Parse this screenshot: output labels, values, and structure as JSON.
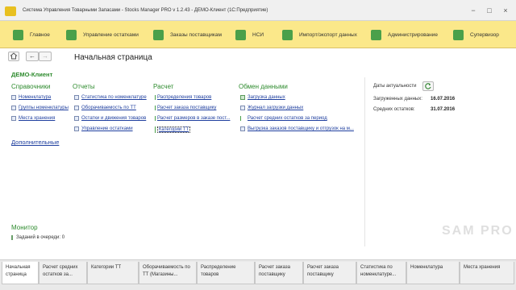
{
  "window": {
    "title": "Система Управления Товарными Запасами - Stocks Manager PRO v 1.2.43 - ДЕМО-Клиент (1С:Предприятие)",
    "controls": [
      "−",
      "□",
      "×"
    ]
  },
  "sections": [
    {
      "label": "Главное",
      "icon": "home-icon",
      "color": "#4aa04a"
    },
    {
      "label": "Управление остатками",
      "icon": "stock-icon",
      "color": "#4aa04a"
    },
    {
      "label": "Заказы поставщикам",
      "icon": "orders-icon",
      "color": "#4aa04a"
    },
    {
      "label": "НСИ",
      "icon": "reference-data-icon",
      "color": "#4aa04a"
    },
    {
      "label": "Импорт/экспорт данных",
      "icon": "import-export-icon",
      "color": "#4aa04a"
    },
    {
      "label": "Администрирование",
      "icon": "admin-icon",
      "color": "#4aa04a"
    },
    {
      "label": "Супервизор",
      "icon": "supervisor-icon",
      "color": "#4aa04a"
    }
  ],
  "nav": {
    "home_icon": "house-icon",
    "back": "←",
    "forward": "→",
    "page_title": "Начальная страница"
  },
  "client_name": "ДЕМО-Клиент",
  "columns": [
    {
      "title": "Справочники",
      "links": [
        "Номенклатура",
        "Группы номенклатуры",
        "Места хранения"
      ]
    },
    {
      "title": "Отчеты",
      "links": [
        "Статистика по номенклатуре",
        "Оборачиваемость по ТТ",
        "Остатки и движения товаров",
        "Управление остатками"
      ]
    },
    {
      "title": "Расчет",
      "links": [
        "Распределения товаров",
        "Расчет заказа поставщику",
        "Расчет размеров в заказе пост...",
        "Категории ТТ"
      ]
    },
    {
      "title": "Обмен данными",
      "links": [
        "Загрузка данных",
        "Журнал загрузки данных",
        "Расчет средних остатков за период",
        "Выгрузка заказов поставщику и отгрузок на м..."
      ]
    }
  ],
  "more_link": "Дополнительные",
  "dates": {
    "title": "Даты актуальности",
    "rows": [
      {
        "label": "Загруженных данных:",
        "value": "16.07.2016"
      },
      {
        "label": "Средних остатков:",
        "value": "31.07.2016"
      }
    ]
  },
  "monitor": {
    "title": "Монитор",
    "text": "Заданий в очереди: 0"
  },
  "tabs": [
    {
      "label": "Начальная страница",
      "active": true
    },
    {
      "label": "Расчет средних остатков за...",
      "active": false
    },
    {
      "label": "Категории ТТ",
      "active": false
    },
    {
      "label": "Оборачиваемость по ТТ (Магазины...",
      "active": false
    },
    {
      "label": "Распределение товаров",
      "active": false
    },
    {
      "label": "Расчет заказа поставщику",
      "active": false
    },
    {
      "label": "Расчет заказа поставщику",
      "active": false
    },
    {
      "label": "Статистика по номенклатуре...",
      "active": false
    },
    {
      "label": "Номенклатура",
      "active": false
    },
    {
      "label": "Места хранения",
      "active": false
    }
  ],
  "watermark": "SAM PRO"
}
